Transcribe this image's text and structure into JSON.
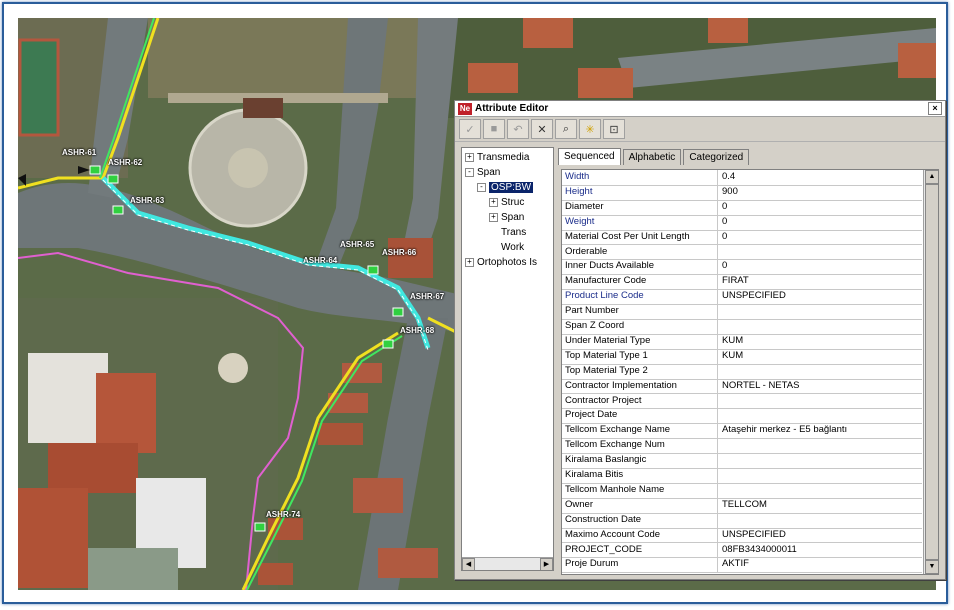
{
  "map": {
    "labels": [
      "ASHR-61",
      "ASHR-62",
      "ASHR-63",
      "ASHR-65",
      "ASHR-64",
      "ASHR-66",
      "ASHR-67",
      "ASHR-68",
      "ASHR-74"
    ]
  },
  "editor": {
    "title": "Attribute Editor",
    "app_icon": "Ne",
    "close": "×",
    "toolbar": [
      "check-icon",
      "stop-icon",
      "undo-icon",
      "cross-icon",
      "find-icon",
      "flash-icon",
      "zoom-to-icon"
    ],
    "tree": {
      "items": [
        {
          "label": "Transmedia",
          "expander": "+",
          "level": 0
        },
        {
          "label": "Span",
          "expander": "-",
          "level": 0
        },
        {
          "label": "OSP:BW",
          "expander": "-",
          "level": 1,
          "selected": true
        },
        {
          "label": "Struc",
          "expander": "+",
          "level": 2
        },
        {
          "label": "Span",
          "expander": "+",
          "level": 2
        },
        {
          "label": "Trans",
          "expander": "",
          "level": 2
        },
        {
          "label": "Work",
          "expander": "",
          "level": 2
        },
        {
          "label": "Ortophotos Is",
          "expander": "+",
          "level": 0
        }
      ]
    },
    "tabs": [
      "Sequenced",
      "Alphabetic",
      "Categorized"
    ],
    "active_tab": "Sequenced",
    "rows": [
      {
        "key": "Width",
        "value": "0.4",
        "blue": true
      },
      {
        "key": "Height",
        "value": "900",
        "blue": true
      },
      {
        "key": "Diameter",
        "value": "0",
        "blue": false
      },
      {
        "key": "Weight",
        "value": "0",
        "blue": true
      },
      {
        "key": "Material Cost Per Unit Length",
        "value": "0",
        "blue": false
      },
      {
        "key": "Orderable",
        "value": "",
        "blue": false
      },
      {
        "key": "Inner Ducts Available",
        "value": "0",
        "blue": false
      },
      {
        "key": "Manufacturer Code",
        "value": "FIRAT",
        "blue": false
      },
      {
        "key": "Product Line Code",
        "value": "UNSPECIFIED",
        "blue": true
      },
      {
        "key": "Part Number",
        "value": "",
        "blue": false
      },
      {
        "key": "Span Z Coord",
        "value": "",
        "blue": false
      },
      {
        "key": "Under Material Type",
        "value": "KUM",
        "blue": false
      },
      {
        "key": "Top Material Type 1",
        "value": "KUM",
        "blue": false
      },
      {
        "key": "Top Material Type 2",
        "value": "",
        "blue": false
      },
      {
        "key": "Contractor Implementation",
        "value": "NORTEL - NETAS",
        "blue": false
      },
      {
        "key": "Contractor Project",
        "value": "",
        "blue": false
      },
      {
        "key": "Project Date",
        "value": "",
        "blue": false
      },
      {
        "key": "Tellcom Exchange Name",
        "value": "Ataşehir merkez - E5 bağlantı",
        "blue": false
      },
      {
        "key": "Tellcom Exchange Num",
        "value": "",
        "blue": false
      },
      {
        "key": "Kiralama Baslangic",
        "value": "",
        "blue": false
      },
      {
        "key": "Kiralama Bitis",
        "value": "",
        "blue": false
      },
      {
        "key": "Tellcom Manhole Name",
        "value": "",
        "blue": false
      },
      {
        "key": "Owner",
        "value": "TELLCOM",
        "blue": false
      },
      {
        "key": "Construction Date",
        "value": "",
        "blue": false
      },
      {
        "key": "Maximo Account Code",
        "value": "UNSPECIFIED",
        "blue": false
      },
      {
        "key": "PROJECT_CODE",
        "value": "08FB3434000011",
        "blue": false
      },
      {
        "key": "Proje Durum",
        "value": "AKTIF",
        "blue": false
      }
    ]
  }
}
